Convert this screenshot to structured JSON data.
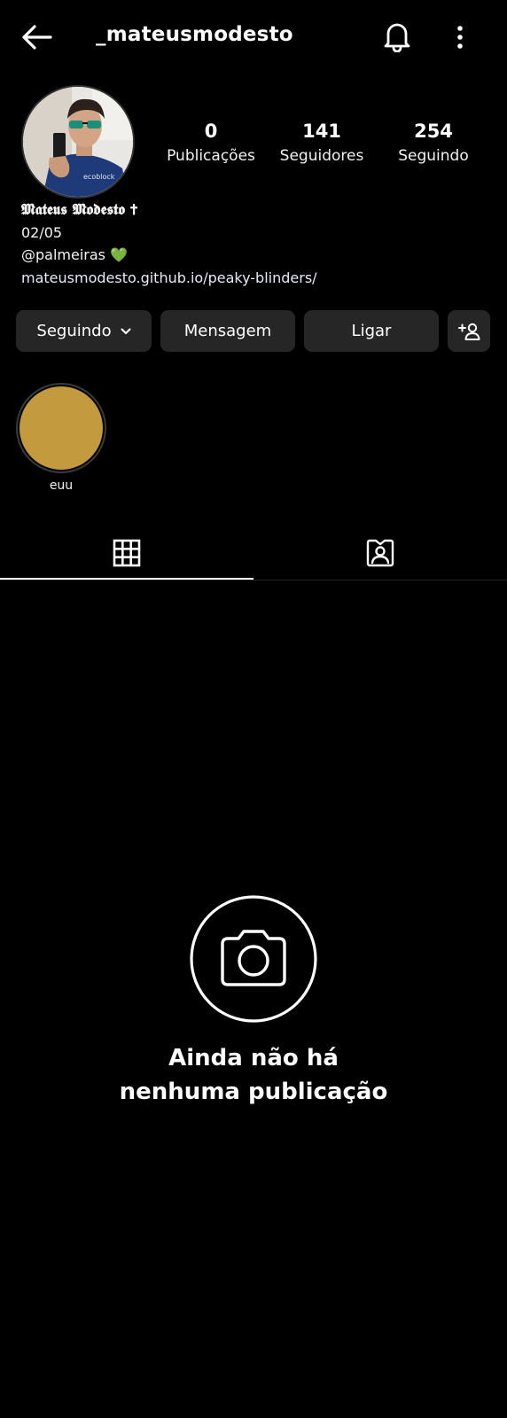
{
  "header": {
    "username": "_mateusmodesto",
    "back_icon": "arrow-left-icon",
    "notification_icon": "bell-icon",
    "more_icon": "more-vertical-icon"
  },
  "profile": {
    "avatar_icon": "profile-photo",
    "stats": [
      {
        "value": "0",
        "label": "Publicações"
      },
      {
        "value": "141",
        "label": "Seguidores"
      },
      {
        "value": "254",
        "label": "Seguindo"
      }
    ],
    "bio": {
      "name": "𝕸𝖆𝖙𝖊𝖚𝖘 𝕸𝖔𝖉𝖊𝖘𝖙𝖔 ✝",
      "date": "02/05",
      "mention": "@palmeiras 💚",
      "link": "mateusmodesto.github.io/peaky-blinders/"
    }
  },
  "actions": {
    "following_label": "Seguindo",
    "message_label": "Mensagem",
    "call_label": "Ligar",
    "add_user_icon": "add-person-icon"
  },
  "highlights": [
    {
      "label": "euu",
      "color": "#c39a3e"
    }
  ],
  "tabs": [
    {
      "icon": "grid-icon",
      "active": true
    },
    {
      "icon": "tagged-person-icon",
      "active": false
    }
  ],
  "empty_state": {
    "icon": "camera-icon",
    "line1": "Ainda não há",
    "line2": "nenhuma publicação"
  },
  "colors": {
    "background": "#000000",
    "button_bg": "#262626",
    "text": "#ffffff"
  }
}
